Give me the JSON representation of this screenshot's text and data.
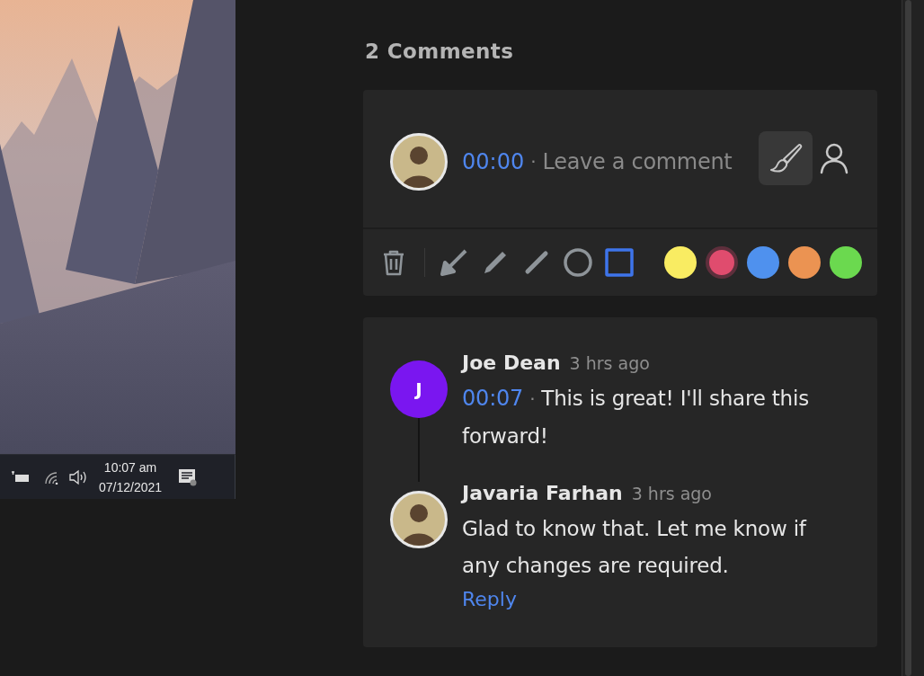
{
  "video": {
    "taskbar": {
      "time": "10:07 am",
      "date": "07/12/2021"
    }
  },
  "comments_header": "2 Comments",
  "separator": "·",
  "composer": {
    "timestamp": "00:00",
    "placeholder": "Leave a comment",
    "brush_selected": true
  },
  "tools": [
    {
      "kind": "arrow",
      "selected": false
    },
    {
      "kind": "pencil",
      "selected": false
    },
    {
      "kind": "line",
      "selected": false
    },
    {
      "kind": "circle",
      "selected": false
    },
    {
      "kind": "rectangle",
      "selected": true
    }
  ],
  "colors": [
    {
      "color": "#f9ec62",
      "selected": false
    },
    {
      "color": "#e04c6e",
      "selected": true
    },
    {
      "color": "#4f91ee",
      "selected": false
    },
    {
      "color": "#eb9352",
      "selected": false
    },
    {
      "color": "#6bd94f",
      "selected": false
    }
  ],
  "thread": [
    {
      "author": "Joe Dean",
      "time": "3 hrs ago",
      "avatar": {
        "kind": "initial",
        "text": "J",
        "color": "#7a16f0"
      },
      "timestamp": "00:07",
      "text": "This is great! I'll share this forward!"
    },
    {
      "author": "Javaria Farhan",
      "time": "3 hrs ago",
      "avatar": {
        "kind": "photo"
      },
      "text": "Glad to know that. Let me know if any changes are required."
    }
  ],
  "reply_label": "Reply"
}
